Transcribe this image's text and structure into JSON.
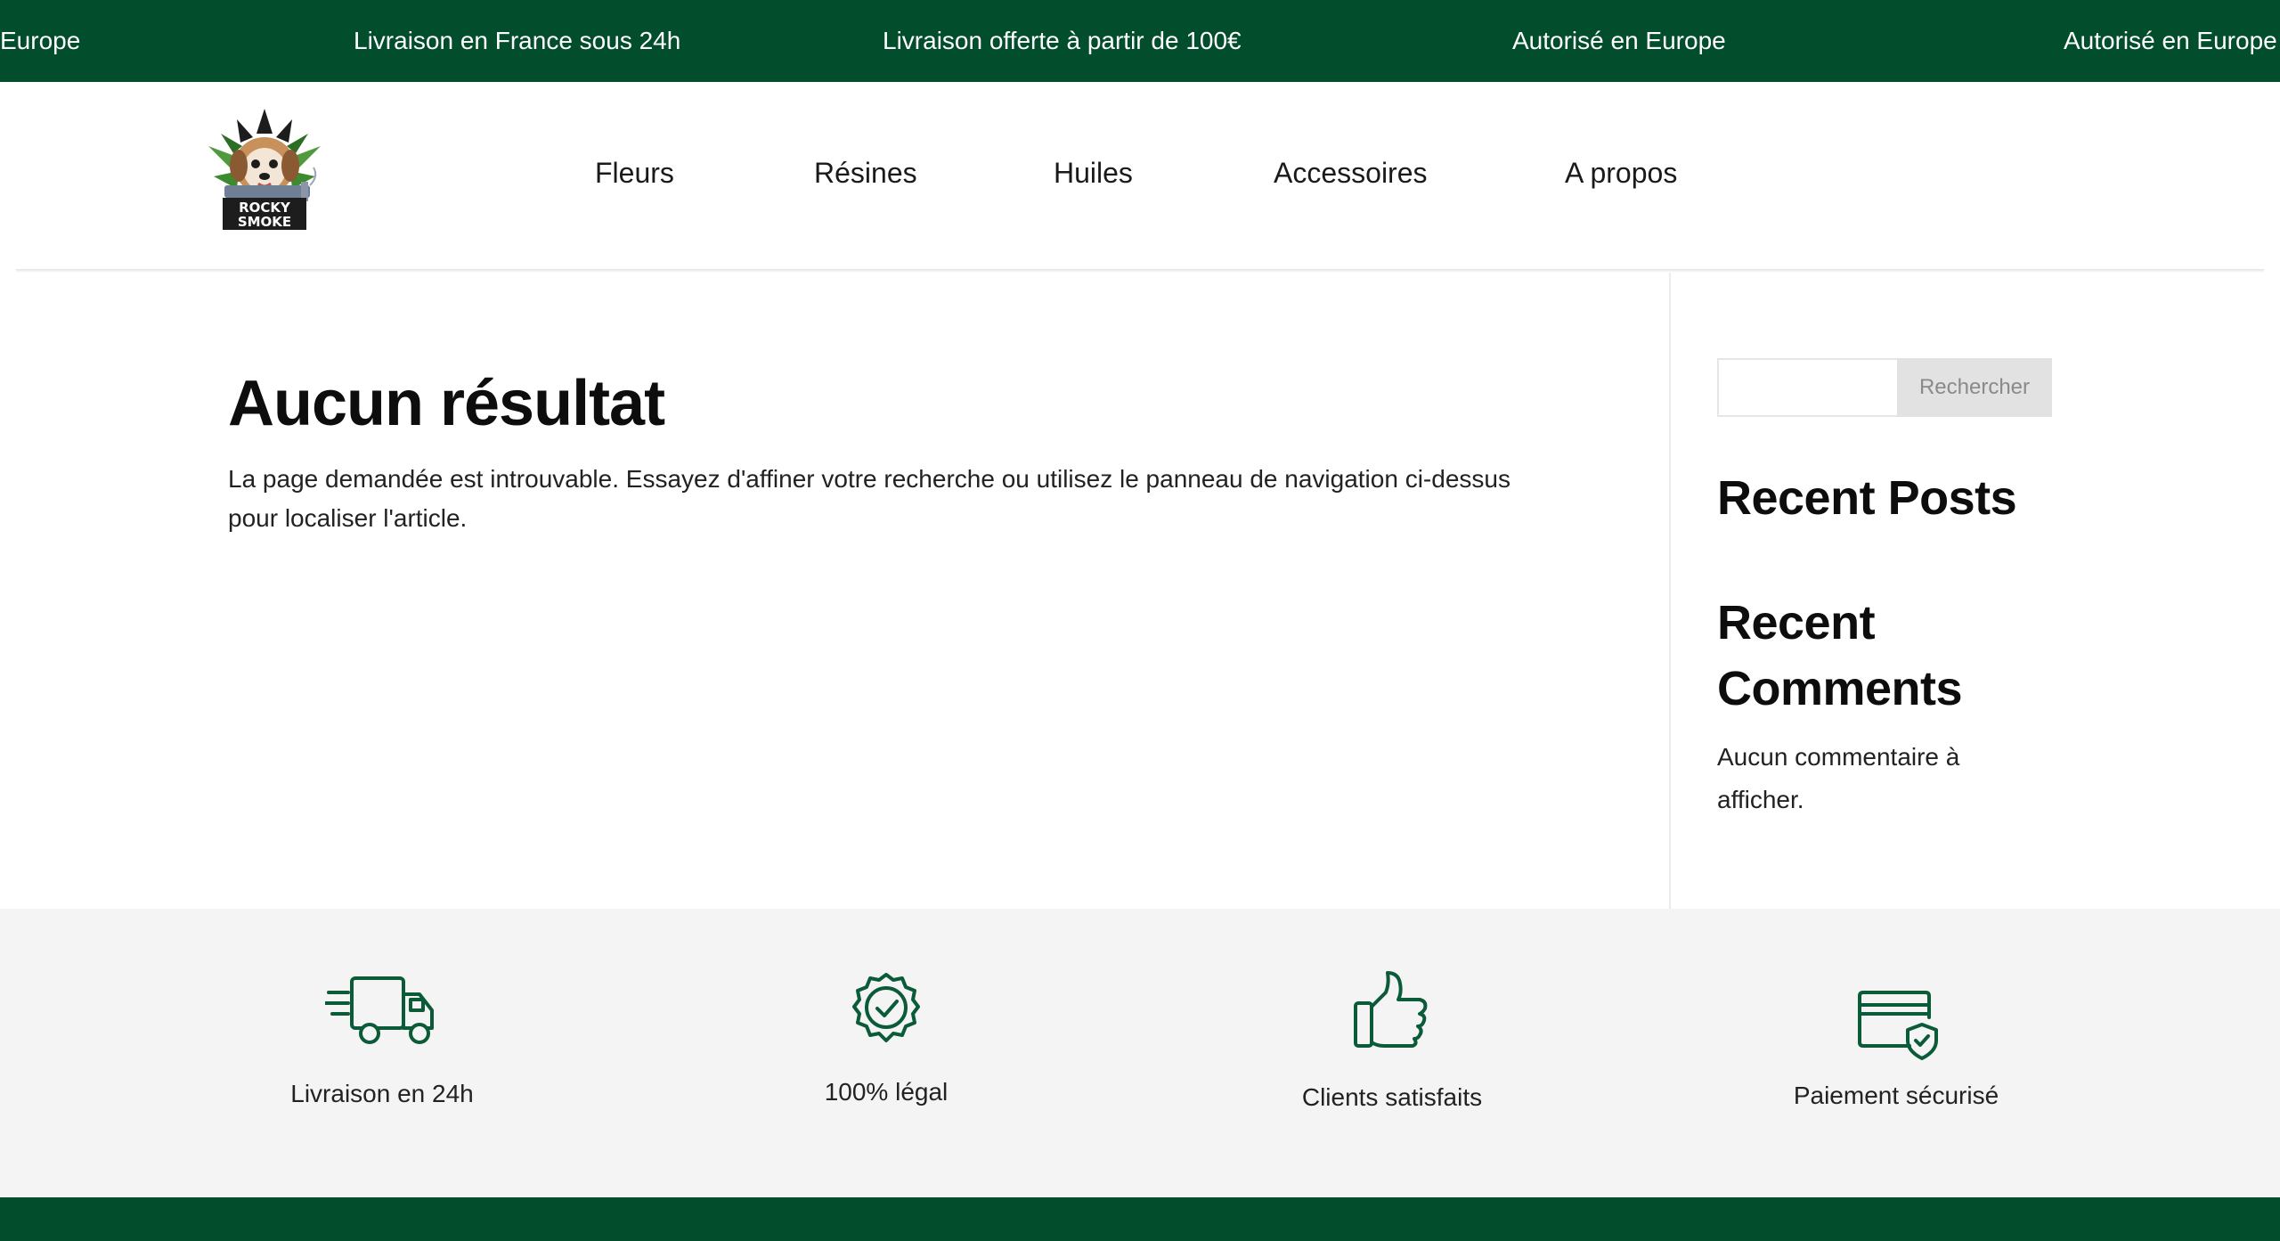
{
  "ticker": {
    "items": [
      "Europe",
      "Livraison en France sous 24h",
      "Livraison offerte à partir de 100€",
      "Autorisé en Europe",
      "Autorisé en Europe"
    ]
  },
  "header": {
    "logo_alt": "Rocky Smoke",
    "logo_text_1": "ROCKY",
    "logo_text_2": "SMOKE",
    "nav": [
      "Fleurs",
      "Résines",
      "Huiles",
      "Accessoires",
      "A propos"
    ]
  },
  "main": {
    "title": "Aucun résultat",
    "text": "La page demandée est introuvable. Essayez d'affiner votre recherche ou utilisez le panneau de navigation ci-dessus pour localiser l'article."
  },
  "sidebar": {
    "search": {
      "value": "",
      "button": "Rechercher"
    },
    "recent_posts_title": "Recent Posts",
    "recent_comments_title": "Recent Comments",
    "no_comments": "Aucun commentaire à afficher."
  },
  "features": [
    {
      "label": "Livraison en 24h",
      "icon": "delivery-truck-icon"
    },
    {
      "label": "100% légal",
      "icon": "verified-badge-icon"
    },
    {
      "label": "Clients satisfaits",
      "icon": "thumbs-up-icon"
    },
    {
      "label": "Paiement sécurisé",
      "icon": "secure-card-icon"
    }
  ],
  "colors": {
    "brand_green": "#014d2c",
    "icon_green": "#0b5a38",
    "band_gray": "#f4f4f4"
  }
}
